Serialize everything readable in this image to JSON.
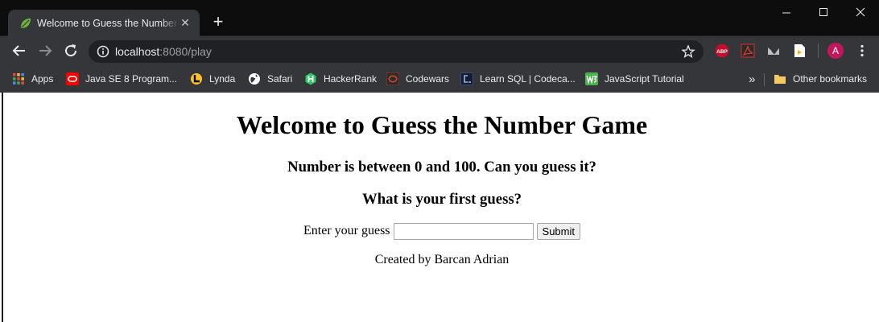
{
  "browser": {
    "tab_title": "Welcome to Guess the Number Game",
    "url_host": "localhost",
    "url_rest": ":8080/play",
    "profile_initial": "A",
    "abp_label": "ABP"
  },
  "bookmarks": [
    {
      "label": "Apps",
      "icon": "apps-grid-icon",
      "color": "#e8453c"
    },
    {
      "label": "Java SE 8 Program...",
      "icon": "oracle-icon",
      "color": "#f80000"
    },
    {
      "label": "Lynda",
      "icon": "lynda-icon",
      "color": "#ffc423"
    },
    {
      "label": "Safari",
      "icon": "safari-globe-icon",
      "color": "#ffffff"
    },
    {
      "label": "HackerRank",
      "icon": "hackerrank-icon",
      "color": "#2ec866"
    },
    {
      "label": "Codewars",
      "icon": "codewars-icon",
      "color": "#b1361e"
    },
    {
      "label": "Learn SQL | Codeca...",
      "icon": "codecademy-icon",
      "color": "#1f4056"
    },
    {
      "label": "JavaScript Tutorial",
      "icon": "w3schools-icon",
      "color": "#4caf50"
    }
  ],
  "other_bookmarks": "Other bookmarks",
  "overflow_label": "»",
  "page": {
    "heading": "Welcome to Guess the Number Game",
    "subheading": "Number is between 0 and 100. Can you guess it?",
    "prompt": "What is your first guess?",
    "input_label": "Enter your guess",
    "input_value": "",
    "submit_label": "Submit",
    "credit": "Created by Barcan Adrian"
  }
}
